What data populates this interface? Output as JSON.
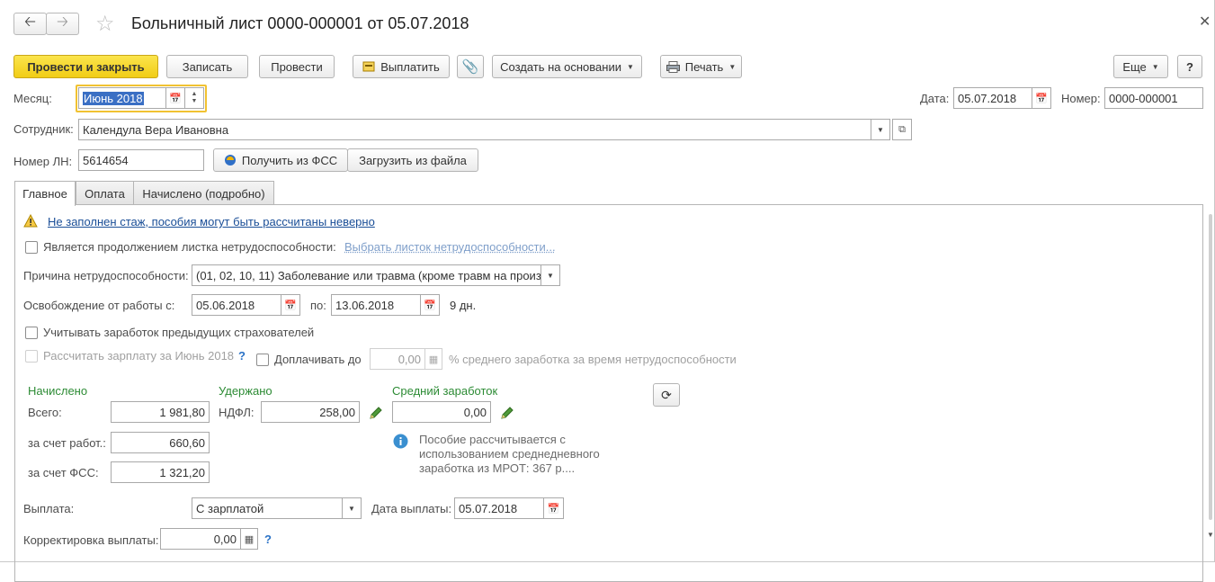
{
  "header": {
    "title": "Больничный лист 0000-000001 от 05.07.2018"
  },
  "toolbar": {
    "post_close": "Провести и закрыть",
    "save": "Записать",
    "post": "Провести",
    "pay": "Выплатить",
    "create_based_on": "Создать на основании",
    "print": "Печать",
    "more": "Еще",
    "help": "?"
  },
  "form": {
    "month_label": "Месяц:",
    "month_value": "Июнь 2018",
    "date_label": "Дата:",
    "date_value": "05.07.2018",
    "number_label": "Номер:",
    "number_value": "0000-000001",
    "employee_label": "Сотрудник:",
    "employee_value": "Календула Вера Ивановна",
    "ln_label": "Номер ЛН:",
    "ln_value": "5614654",
    "get_fss": "Получить из ФСС",
    "load_file": "Загрузить из файла"
  },
  "tabs": [
    "Главное",
    "Оплата",
    "Начислено (подробно)"
  ],
  "main": {
    "warning_link": "Не заполнен стаж, пособия могут быть рассчитаны неверно",
    "continuation_label": "Является продолжением листка нетрудоспособности:",
    "continuation_link": "Выбрать листок нетрудоспособности...",
    "reason_label": "Причина нетрудоспособности:",
    "reason_value": "(01, 02, 10, 11) Заболевание или травма (кроме травм на произв",
    "release_label": "Освобождение от работы с:",
    "release_from": "05.06.2018",
    "release_to_label": "по:",
    "release_to": "13.06.2018",
    "days": "9 дн.",
    "prev_insurers": "Учитывать заработок предыдущих страхователей",
    "calc_salary": "Рассчитать зарплату за Июнь 2018",
    "calc_help": "?",
    "topup_label": "Доплачивать до",
    "topup_value": "0,00",
    "topup_suffix": "% среднего заработка за время нетрудоспособности"
  },
  "totals": {
    "accrued_title": "Начислено",
    "total_label": "Всего:",
    "total_value": "1 981,80",
    "employer_label": "за счет работ.:",
    "employer_value": "660,60",
    "fss_label": "за счет ФСС:",
    "fss_value": "1 321,20",
    "withheld_title": "Удержано",
    "ndfl_label": "НДФЛ:",
    "ndfl_value": "258,00",
    "avg_title": "Средний заработок",
    "avg_value": "0,00",
    "info": "Пособие рассчитывается с использованием среднедневного заработка из МРОТ: 367 р...."
  },
  "payment": {
    "payout_label": "Выплата:",
    "payout_value": "С зарплатой",
    "payout_date_label": "Дата выплаты:",
    "payout_date": "05.07.2018",
    "adjust_label": "Корректировка выплаты:",
    "adjust_value": "0,00",
    "adjust_help": "?"
  }
}
